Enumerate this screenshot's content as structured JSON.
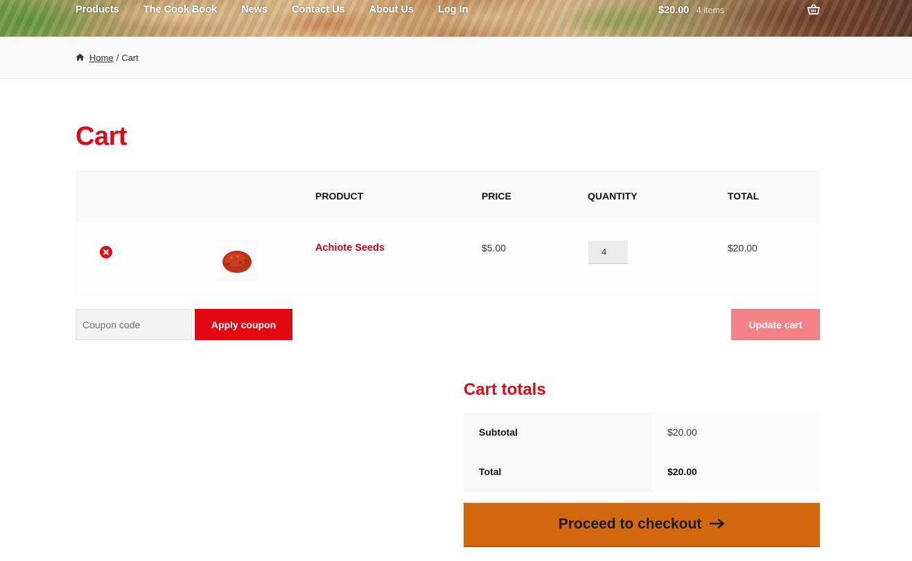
{
  "header": {
    "nav": [
      "Products",
      "The Cook Book",
      "News",
      "Contact Us",
      "About Us",
      "Log In"
    ],
    "cart_amount": "$20.00",
    "cart_count": "4 items",
    "basket_icon": "basket-icon"
  },
  "breadcrumb": {
    "home_icon": "home-icon",
    "home": "Home",
    "separator": "/",
    "current": "Cart"
  },
  "page": {
    "title": "Cart"
  },
  "cart_table": {
    "columns": [
      "PRODUCT",
      "PRICE",
      "QUANTITY",
      "TOTAL"
    ],
    "rows": [
      {
        "remove_icon": "remove-icon",
        "product": "Achiote Seeds",
        "price": "$5.00",
        "quantity": "4",
        "total": "$20.00"
      }
    ]
  },
  "coupon": {
    "placeholder": "Coupon code",
    "apply_label": "Apply coupon",
    "update_label": "Update cart"
  },
  "totals": {
    "title": "Cart totals",
    "subtotal_label": "Subtotal",
    "subtotal_value": "$20.00",
    "total_label": "Total",
    "total_value": "$20.00",
    "checkout_label": "Proceed to checkout",
    "checkout_icon": "arrow-right-icon"
  },
  "colors": {
    "brand_red": "#e30613",
    "checkout_orange": "#d2690e",
    "update_pink": "#f38288"
  }
}
